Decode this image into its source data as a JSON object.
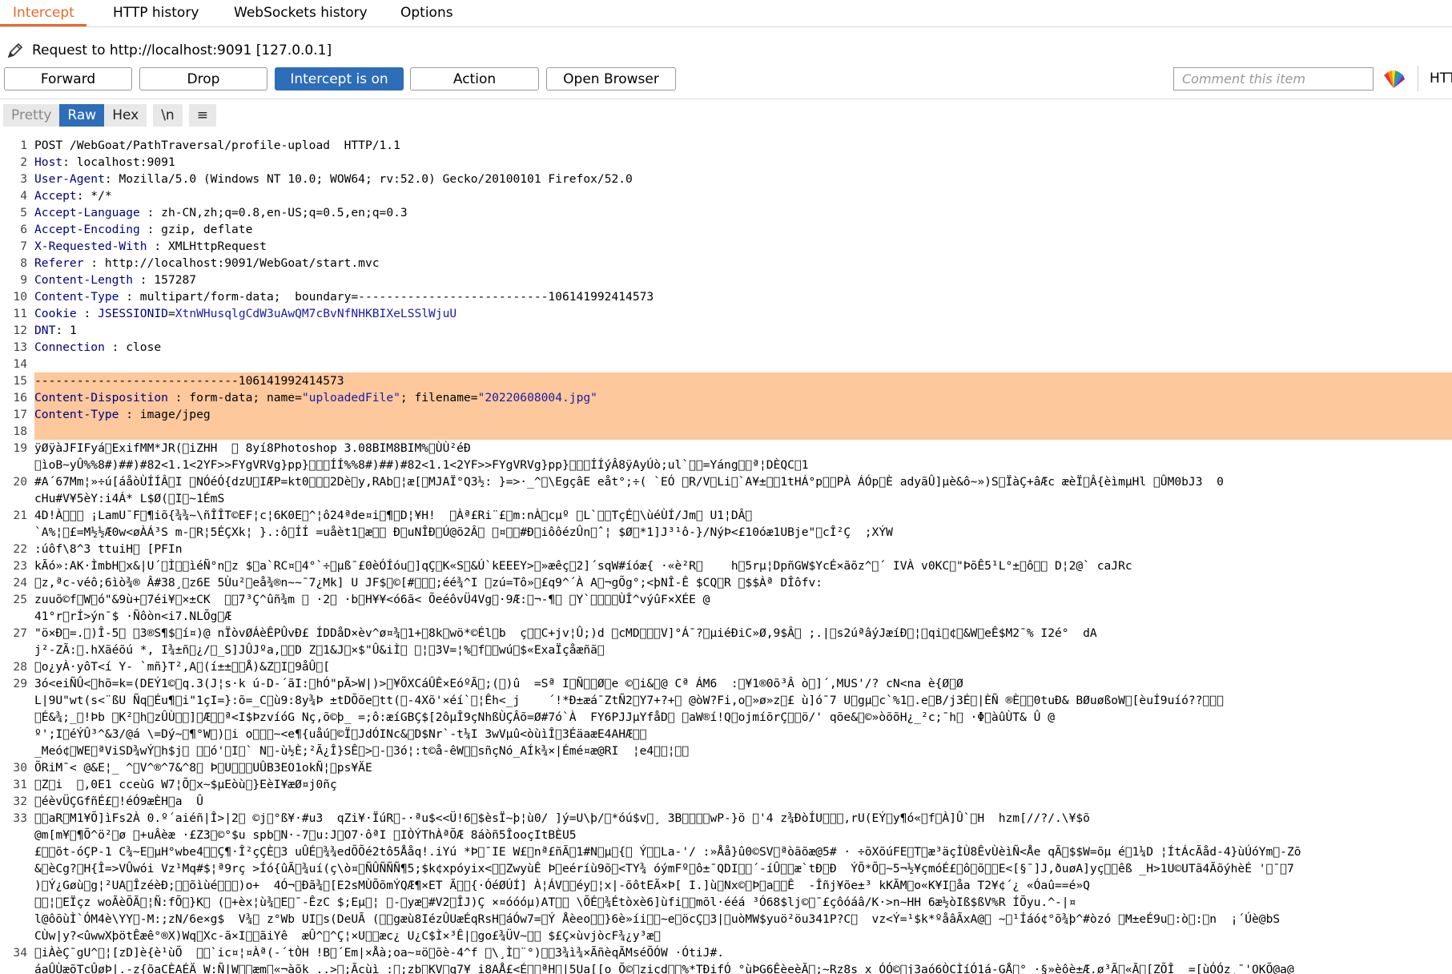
{
  "tabs": [
    "Intercept",
    "HTTP history",
    "WebSockets history",
    "Options"
  ],
  "request_label": "Request to http://localhost:9091  [127.0.0.1]",
  "buttons": {
    "forward": "Forward",
    "drop": "Drop",
    "intercept": "Intercept is on",
    "action": "Action",
    "open_browser": "Open Browser"
  },
  "comment_placeholder": "Comment this item",
  "http_trunc": "HTT",
  "view_tabs": [
    "Pretty",
    "Raw",
    "Hex",
    "\\n",
    "≡"
  ],
  "request_lines": [
    {
      "n": "1",
      "text": "POST /WebGoat/PathTraversal/profile-upload  HTTP/1.1"
    },
    {
      "n": "2",
      "key": "Host",
      "sep": ": ",
      "val": "localhost:9091"
    },
    {
      "n": "3",
      "key": "User-Agent",
      "sep": ": ",
      "val": "Mozilla/5.0 (Windows NT 10.0; WOW64; rv:52.0) Gecko/20100101 Firefox/52.0"
    },
    {
      "n": "4",
      "key": "Accept",
      "sep": ": ",
      "val": "*/*"
    },
    {
      "n": "5",
      "key": "Accept-Language",
      "sep": " : ",
      "val": "zh-CN,zh;q=0.8,en-US;q=0.5,en;q=0.3"
    },
    {
      "n": "6",
      "key": "Accept-Encoding",
      "sep": " : ",
      "val": "gzip, deflate"
    },
    {
      "n": "7",
      "key": "X-Requested-With",
      "sep": " : ",
      "val": "XMLHttpRequest"
    },
    {
      "n": "8",
      "key": "Referer",
      "sep": " : ",
      "val": "http://localhost:9091/WebGoat/start.mvc"
    },
    {
      "n": "9",
      "key": "Content-Length",
      "sep": " : ",
      "val": "157287"
    },
    {
      "n": "10",
      "key": "Content-Type",
      "sep": " : ",
      "val": "multipart/form-data;  boundary=---------------------------106141992414573"
    },
    {
      "n": "11",
      "key": "Cookie",
      "sep": " : ",
      "cookie_name": "JSESSIONID",
      "cookie_eq": "=",
      "cookie_val": "XtnWHusqlgCdW3uAwQM7cBvNfNHKBIXeLSSlWjuU"
    },
    {
      "n": "12",
      "key": "DNT",
      "sep": ": ",
      "val": "1"
    },
    {
      "n": "13",
      "key": "Connection",
      "sep": " : ",
      "val": "close"
    },
    {
      "n": "14",
      "text": ""
    },
    {
      "n": "15",
      "hl": true,
      "text": "-----------------------------106141992414573"
    },
    {
      "n": "16",
      "hl": true,
      "key": "Content-Disposition",
      "sep": " : ",
      "val": "form-data; name=",
      "q1": "\"uploadedFile\"",
      "mid": "; filename=",
      "q2": "\"20220608004.jpg\""
    },
    {
      "n": "17",
      "hl": true,
      "key": "Content-Type",
      "sep": " : ",
      "val": "image/jpeg"
    },
    {
      "n": "18",
      "hl": true,
      "text": ""
    },
    {
      "n": "19",
      "text": "ÿØÿàJFIFyá\u0000ExifMM*JR(\u0000iZHH  \u0000 8yí8Photoshop 3.08BIM8BIM%\u0000ÙÙ²éÐ"
    },
    {
      "n": "",
      "text": "\u0000ìoB~yÛ%%8#)##)#82<1.1<2YF>>FYgVRVg}pp}\u0000\u0000\u0000ÍÍ%%8#)##)#82<1.1<2YF>>FYgVRVg}pp}\u0000\u0000\u0000ÍÍýÂ8ÿAyÚò;ul`\u0000\u0000=Yáng\u0000\u0000ª¦DÈQC\u00001"
    },
    {
      "n": "20",
      "text": "#A´67Mm¦»÷ú[áåòÙÍÍÂ\u0000I \u0000NÓéÓ{dzU\u0000IÆP=kt0\u0000\u0000\u00002Dè\u0000y,RAb\u0000¦æ[\u0000MJAÏ°Q3½: }=>·_^\u0000\\EgçâE eåt°;÷( `EÓ \u0000R/V\u0000Li\u0000`A¥±\u0000\u00001tHÁ°p\u0000\u0000PÀ ÁÓp\u0000È adyãÛ]µè&ô~»)S\u0000ÏàÇ+âÆc æèÏ\u0000Â{èìmµHl \u0000ÛM0bJ3  0"
    },
    {
      "n": "",
      "text": "cHu#V¥5èY:i4Á* L$Ø(\u0000I\u0000~1ÉmS"
    },
    {
      "n": "21",
      "text": "4D!À\u0000\u0000\u0000 ¡LamU¯F\u0000¶iõ{¾¾~\\ñÎÎT©EF¦c¦6K0E\u0000^¦ô24ªde¤i\u0000¶\u0000D¦¥H!  \u0000Àª£Ri¨£\u0000m:nÀ\u0000cµº \u0000L`\u0000\u0000TçÉ\u0000\\ùéÙÍ/Jm\u0000 U1¦DÂ\u0000"
    },
    {
      "n": "",
      "text": "`A%¦\u0000£=M½½Æ0w<øÀÁ³S m-\u0000R¦5ÉÇXk¦ }.:ô\u0000ÍÍ =uåèt1\u0000æ\u0000\u0000 Ð\u0000uNÎÐ\u0000Ú@õ2Â\u0000 \u0000¤\u0000\u0000#Ð\u0000iôôézÛn\u0000ˆ¦ $Ø\u0000*1]J³¹ô-}/NýÞ<£10óæ1UBje\"\u0000cÎ²Ç  ;XÝW"
    },
    {
      "n": "22",
      "text": ":úôf\\8^3 ttuiH\u0000 [PFIn"
    },
    {
      "n": "23",
      "text": "kÃó»:AK·ÌmbH\u0000x&|U´\u0000Ì\u0000\u0000ìéÑ°n\u0000z $\u0000a`RC¤\u00004°`÷\u0000µß¯£0èÓÍóu\u0000]qÇ\u0000K«S\u0000&Ú`kEEEY>\u0000»æêç\u00002]´sqW#íóæ{ ·«è²R\u0000    h\u00005rµ¦DpñGW$YcÉ×ãõz^\u0000´ IVÀ v0KC\u0000\"ÞõÊ5¹L°±\u0000ô\u0000\u0000 D¦2@` caJRc"
    },
    {
      "n": "24",
      "text": "\u0000z,ªc-véô;6ìò¾® Â#38¸\u0000z6E 5Ùu²\u0000eå¾®n~~¯7¿Mk] U JF$\u0000©[#\u0000\u0000\u0000;éé¾^I \u0000zú=Tô»\u0000£q9^´À A\u0000¬gÕg°;<þNÎ-Ê $CQ\u0000R \u0000$$Àª DÎôfv:"
    },
    {
      "n": "25",
      "text": "zuuõ©f\u0000W\u0000ó\"&9ù+\u00007éi¥\u0000×±CK  \u0000\u00007³Ç^ûñ¾m \u0000 ·2\u0000 ·b\u0000H¥¥<ó6ã< ÕeéôvÜ4Vg\u0000·9Æ:\u0000¬-¶\u0000 \u0000Y`\u0000\u0000\u0000\u0000ÙÎ^výûF×XÉE @"
    },
    {
      "n": "",
      "text": "41°r\u0000rÍ>ýn¯$ ·Ñôòn<i7.NLÕg\u0000Æ"
    },
    {
      "n": "27",
      "text": "\"ö×Ð\u0000=.\u0000)Î-5\u0000 \u00003®S¶$\u0000í¤)@ nÏòvØÁèÊPÛvÐ£ ÍDDåD×èv^ø¤¾\u00001+\u00008k\u0000wö*©Él\u0000b  ç\u0000\u0000C+jv¦Û;)d \u0000cMD\u0000\u0000\u0000V]°Á¯?\u0000µiéÐiC»Ø,9$Â\u0000 ;.|\u0000s2úªâýJæíÐ\u0000¦\u0000qi\u0000¢\u0000&W\u0000eÊ$M2¯% I2é°  dA"
    },
    {
      "n": "",
      "text": "j²-ZÃ:\u0000.hXãéõú *, I¾±ñ\u0000¿/\u0000_S]JÛJºa,\u0000\u0000D Z\u00001&J\u0000×$\"Û&iÌ\u0000 \u0000¦\u00003V=¦%\u0000f\u0000\u0000wú\u0000$«ExaÏçåæñã\u0000"
    },
    {
      "n": "28",
      "text": "\u0000o¿yÀ·yôT<í Y- `mñ}T²,A\u0000(í±±\u0000\u0000Å)&Z\u0000I\u00009åÛ\u0000["
    },
    {
      "n": "29",
      "text": "3ó<eiÑÛ<\u0000hõ=k=(DEÝ1©\u0000q.3(J¦s·k ú-D-´ãI:\u0000hÓ\"pÃ>W|)>\u0000¥ÕXCáÛÊ×EóºÃ\u0000;(\u0000)û  =Sª I\u0000Ñ\u0000\u0000Ø\u0000e ©\u0000i&\u0000@ Cª ÁM6  :\u0000¥1®0õ³Â ò\u0000]´,MUS'/? cN<na è{Ø\u0000Ø"
    },
    {
      "n": "",
      "text": "L|9U\"wt(s<¨ßU Ñq\u0000Éu¶\u0000i\"1çI=}:õ=_C\u0000ù9:8y¾Þ ±tDÕõe\u0000tt(\u0000-4Xõ'×éí`\u0000¦Êh<_j    ´!*Ð±æá¯ZtÑ2\u0000Y7+?+\u0000 @òW?Fi,o\u0000»ø»z\u0000£ ù]ó¯7 U\u0000gµ\u0000c`%1\u0000.e\u0000B/j3É\u0000|ÈÑ ®È\u0000\u00000tuÐ& BØuøßoW\u0000[èuÍ9uíó??\u0000\u0000\u0000"
    },
    {
      "n": "",
      "text": "\u0000É&¾;_\u0000!Þb \u0000K²\u0000h\u0000zÛÙ\u0000\u0000]\u0000Æ\u0000\u0000ª<I$ÞzvíóG Nç,õ©þ_ =;ô:æíGBÇ$[2ôµÎ9çNhßÙÇÂõ=Ø#7ó`À  FY6PJJµYfåD\u0000 \u0000aW®í!Q\u0000ojmíõrÇ\u0000\u0000ö/' qõe&\u0000©»òõõH¿_²c;¯h\u0000 ·Φ\u0000àûÙT& Û @"
    },
    {
      "n": "",
      "text": "º';I\u0000éÝÛ³^&3/@á \\=Dý~\u0000¶°W\u0000)\u0000i o\u0000\u0000\u0000~<e¶{uåú\u0000©Ï\u0000JdÓINc&\u0000D$Nr`-t¼I 3wVµû<òùìÎ\u00003ÉäaæE4AHÆ\u0000\u0000"
    },
    {
      "n": "",
      "text": "_Meó¢\u0000WE\u0000ªViSD¾wÝ\u0000h$j\u0000 \u0000\u0000ó'\u0000I\u0000` N\u0000-ù½È;²Ã¿Î}SÊ\u0000>\u0000-\u00003ó¦:t©å-êW\u0000\u0000sñçNó_AÍk¾×|Émé¤æ@RI  ¦e4\u0000\u0000¦\u0000\u0000"
    },
    {
      "n": "30",
      "text": "ÕRiM¯< @&E¦_ ^\u0000V^®^7&^8\u0000 Þ\u0000U\u0000\u0000\u0000UÛB3EO1okÑ¦\u0000ps¥ÄE"
    },
    {
      "n": "31",
      "text": "\u0000Z\u0000i  \u0000,0E1 cceùG W7¦Õ\u0000x~$µEòù\u0000}EèI¥æØ¤j0ñç"
    },
    {
      "n": "32",
      "text": "\u0000éèvÜÇGfñÉ£\u0000!éÓ9æÈH\u0000a  Û"
    },
    {
      "n": "33",
      "text": "\u0000\u0000aR\u0000M1¥Õ]ìFs2À 0.º´aiéñ|Î>|2\u0000 ©j\u0000°ß¥·#u3  qZi¥·ÏúR\u0000-·ªu$<<Ü!6\u0000$èsÏ~þ¦ù0/ ]ý=U\\þ/\u0000*óú$v\u0000¸ 3B\u0000\u0000\u0000\u0000wP-}ö \u0000'4 z¾ÐòÍU\u0000\u0000\u0000,rU(EÝ\u0000y¶ó«\u0000f\u0000À]Û`\u0000H  hzm[//?/.\\¥$õ"
    },
    {
      "n": "",
      "text": "@m[m¥\u0000¶Õ^ö²\u0000ø \u0000+uÂèæ ·£Z3\u0000©°$u spb\u0000N·-7\u0000u:J\u0000O7·ôªI \u0000IÒÝThÀªÕÆ 8áòñ5ÎooçItBÈU5"
    },
    {
      "n": "",
      "text": "£\u0000\u0000õt-óÇP-1 C¾~E\u0000µH°wbe4\u0000\u0000Ç¶·Î²çÇÈ\u00003 uÛÉ\u0000¾¾edÕÕé2tô5Ååq!.iYú *Þ\u0000¯IE W£\u0000nª£ñÃ\u00001#N\u0000µ\u0000{\u0000 Ý\u0000\u0000La-'/ :»Åå}û0©SV\u0000ªòãõæ@5# · ÷õXõúFE\u0000T\u0000æ³äçÌÙ8ÊvÙèìÑ<Åe qÃ\u0000$$W=õµ é\u00001¼D ¦ÍtÁcÃåd-4}ùÚóYm\u0000-Zõ"
    },
    {
      "n": "",
      "text": "&\u0000èCg?\u0000H{Î=>VÛwói Vz¹Mq#$¦ª9rç >Íó{ûÃ\u0000¾uí(ç\\ò¤\u0000ÑÛÑÑÑ¶5;$k¢xpóyix<\u0000\u0000ZwyùÊ Þ\u0000eéríù9õ\u0000<TY¾ óýmFº\u0000ô±¯QDI\u0000\u0000´-íÛ\u0000\u0000æ`tÐ\u0000Ð  ÝÕ*Õ\u0000~5¬½¥çmóÉ£\u0000ô\u0000õ\u0000\u0000E<[§¯]J,ðuøA]yç\u0000\u0000êß _H>1U©UTã4ÃõýhèÉ '\u0000¯\u00007"
    },
    {
      "n": "",
      "text": ")\u0000Ý¿Gøù\u0000g¦²UA\u0000ÎzéèÐ;\u0000\u0000õìùé\u0000\u0000\u0000)o+  4Ó¬\u0000Ðã¾\u0000[E2sMÙÕõmÝQÆ¶×ET Ã\u0000\u0000{·ÓéØÚÍ] À¦ÁV\u0000\u0000éy\u0000¦x|-õôtEÃ×Þ[ I.]ù\u0000Nx©\u0000Þ\u0000a\u0000\u0000Ê  -Îñj¥õe±³ kKÃM\u0000o«K¥I\u0000åa T2¥¢´¿ «Óaû==é»Q"
    },
    {
      "n": "",
      "text": "\u0000\u0000¦\u0000EÏçz woÃèÕÃ\u0000¦Ñ:fÕ\u0000}K\u0000 (\u0000+èx¦ù¾\u0000E\u0000¯-ÊzC $;Eµ\u0000¦ \u0000-\u0000yæ\u0000#V2\u0000ÎJ)Ç ×¤óóóµ)AT\u0000\u0000 \\ÕÉ\u0000¾Étòxè6]ùfi\u0000\u0000mõl·ééá ³Ó68$lj©\u0000¯£çôóáâ/K·>n~HH 6æ½òIß$ßV%R ÍÕyu.^-|¤"
    },
    {
      "n": "",
      "text": "l@ôõùÌ`ÓM4è\\YY\u0000-M:;zN/6e×g$  V¾\u0000 z°Wb UI\u0000s(DeUÃ (\u0000\u0000gæù8IézÛUæÉqRsH\u0000áÓw7=\u0000Ý Åèeo\u0000\u0000}6è»íi\u0000\u0000~e\u0000öcÇ\u00003|\u0000uòMW$yuö²öu341P?C\u0000  vz<Ý=¹$k*ºåâÃxA@\u0000 ~\u0000¹Íáó¢°õ¾þ^#òzó \u0000M±eÉ9u\u0000:ò\u0000:\u0000n  ¡´Úè@bS"
    },
    {
      "n": "",
      "text": "CÙw|y?<ûwwXþötÊæê°®X)Wq\u0000Xc-ã×I\u0000\u0000ãiYê  æÛ^\u0000^Ç¦×U\u0000\u0000æc¿ U¿C$Ì×³Ê|\u0000go£¾ÜV~\u0000\u0000 $£Ç×ùvjòcF¾¿y³æ\u0000"
    },
    {
      "n": "34",
      "text": "\u0000iÀèÇ¯gU^\u0000¦[zD]è{è¹ùÕ  \u0000\u0000`ic¤¦¤Àª(-´tÒH !B\u0000´Em|×Åà;oa~¤ö\u0000õè-4^f \u0000\\¸Ì\u0000¨°)\u0000\u00003¾ì¾×ÃñèqÃMséÕÓW ·ÓtiJ#."
    },
    {
      "n": "",
      "text": "áaÛÙæõTcÛøÞ|.-z{õaCÈAÉÄ W:Ñ|W\u0000\u0000æm\u0000«¬àõk ..>\u0000;Ãcùì :\u0000;zb\u0000KV\u0000q7¥ i8AÅ£<É\u0000\u0000ªH\u0000|5Ua[[o Õ©\u0000ziçd\u0000\u0000%*TÐifÓ °ùÞG6ÊèeèÃ\u0000;~Rz8s x ÓÓ©\u0000j3aó6ÒCÌíÓ1á-GÅ\u0000° ·§»èôè±Æ.ø³Ã\u0000«Ã\u0000[ZÕÎ  =[ùÓÓz¸¯'OKÕ@a@"
    }
  ]
}
